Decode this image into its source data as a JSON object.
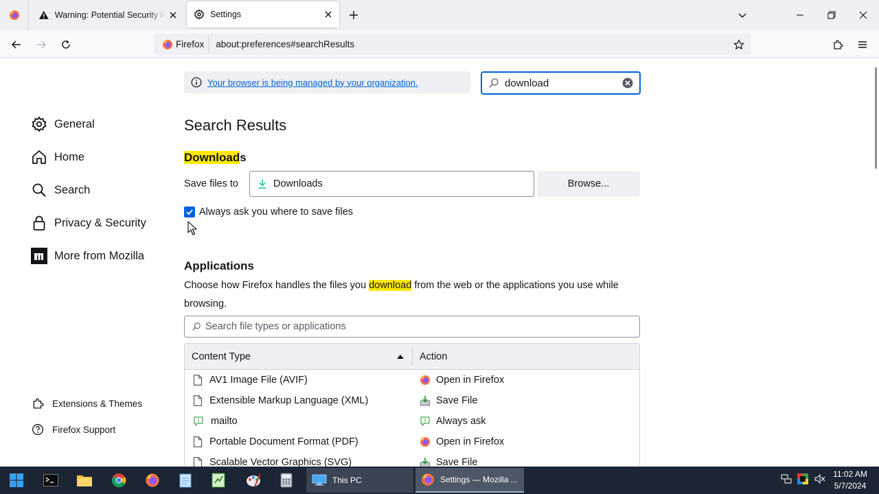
{
  "browser": {
    "tabs": [
      {
        "title": "Warning: Potential Security Risk Ahead",
        "active": false
      },
      {
        "title": "Settings",
        "active": true
      }
    ],
    "identity_label": "Firefox",
    "url": "about:preferences#searchResults"
  },
  "sidebar": {
    "items": [
      {
        "label": "General",
        "icon": "gear-icon"
      },
      {
        "label": "Home",
        "icon": "home-icon"
      },
      {
        "label": "Search",
        "icon": "search-icon"
      },
      {
        "label": "Privacy & Security",
        "icon": "lock-icon"
      },
      {
        "label": "More from Mozilla",
        "icon": "mozilla-m-icon"
      }
    ],
    "footer": [
      {
        "label": "Extensions & Themes",
        "icon": "puzzle-icon"
      },
      {
        "label": "Firefox Support",
        "icon": "help-icon"
      }
    ]
  },
  "managed_notice": "Your browser is being managed by your organization.",
  "search": {
    "value": "download"
  },
  "results_heading": "Search Results",
  "downloads": {
    "heading_highlight": "Download",
    "heading_rest": "s",
    "save_files_label": "Save files to",
    "folder": "Downloads",
    "browse_label": "Browse...",
    "always_ask_label": "Always ask you where to save files",
    "always_ask_checked": true
  },
  "applications": {
    "heading": "Applications",
    "desc_before": "Choose how Firefox handles the files you ",
    "desc_highlight": "download",
    "desc_after": " from the web or the applications you use while browsing.",
    "search_placeholder": "Search file types or applications",
    "columns": {
      "type": "Content Type",
      "action": "Action"
    },
    "rows": [
      {
        "type": "AV1 Image File (AVIF)",
        "type_icon": "file-icon",
        "action": "Open in Firefox",
        "action_icon": "firefox-icon"
      },
      {
        "type": "Extensible Markup Language (XML)",
        "type_icon": "file-icon",
        "action": "Save File",
        "action_icon": "save-file-icon"
      },
      {
        "type": "mailto",
        "type_icon": "chat-icon",
        "action": "Always ask",
        "action_icon": "chat-icon"
      },
      {
        "type": "Portable Document Format (PDF)",
        "type_icon": "file-icon",
        "action": "Open in Firefox",
        "action_icon": "firefox-icon"
      },
      {
        "type": "Scalable Vector Graphics (SVG)",
        "type_icon": "file-icon",
        "action": "Save File",
        "action_icon": "save-file-icon"
      }
    ]
  },
  "taskbar": {
    "tasks": [
      {
        "label": "This PC"
      },
      {
        "label": "Settings — Mozilla ..."
      }
    ],
    "time": "11:02 AM",
    "date": "5/7/2024"
  },
  "colors": {
    "accent": "#0061e0",
    "highlight": "#ffe900",
    "taskbar": "#1c2533"
  }
}
